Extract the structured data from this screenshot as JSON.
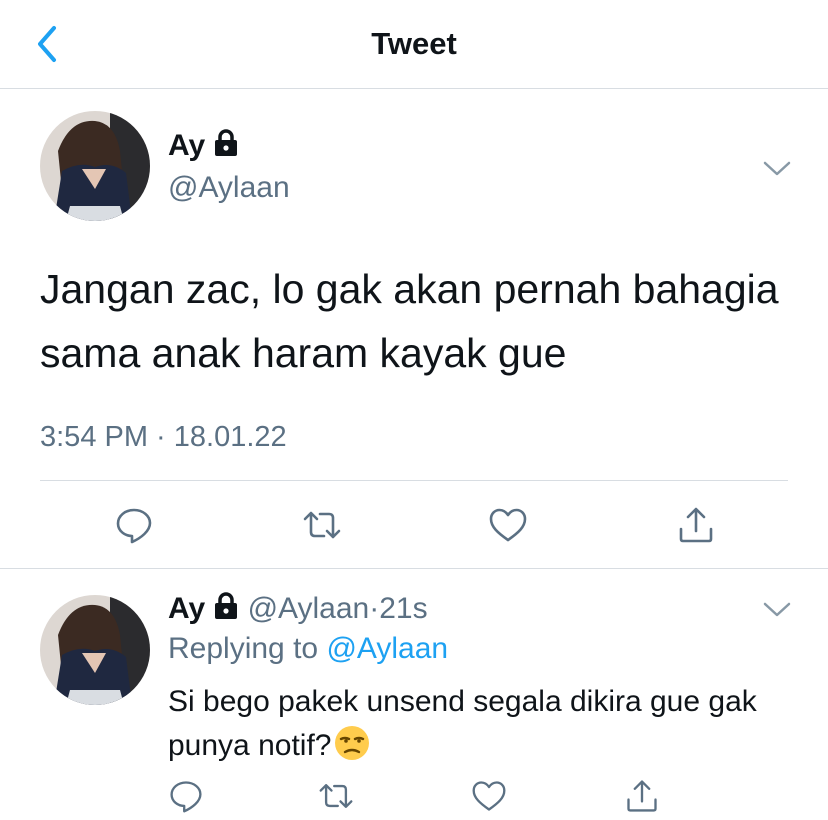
{
  "header": {
    "title": "Tweet",
    "accent": "#1da1f2"
  },
  "main_tweet": {
    "display_name": "Ay",
    "handle": "@Aylaan",
    "text": "Jangan zac, lo gak akan pernah bahagia sama anak haram kayak gue",
    "timestamp": "3:54 PM · 18.01.22"
  },
  "reply": {
    "display_name": "Ay",
    "handle": "@Aylaan",
    "dot": "·",
    "time": "21s",
    "replying_prefix": "Replying to",
    "replying_to": "@Aylaan",
    "text": "Si bego pakek unsend segala dikira gue gak punya notif?"
  },
  "icons": {
    "back": "chevron-left-icon",
    "lock": "lock-icon",
    "more": "chevron-down-icon",
    "reply": "comment-icon",
    "retweet": "retweet-icon",
    "like": "heart-icon",
    "share": "share-icon",
    "emoji": "unamused-face-emoji"
  }
}
